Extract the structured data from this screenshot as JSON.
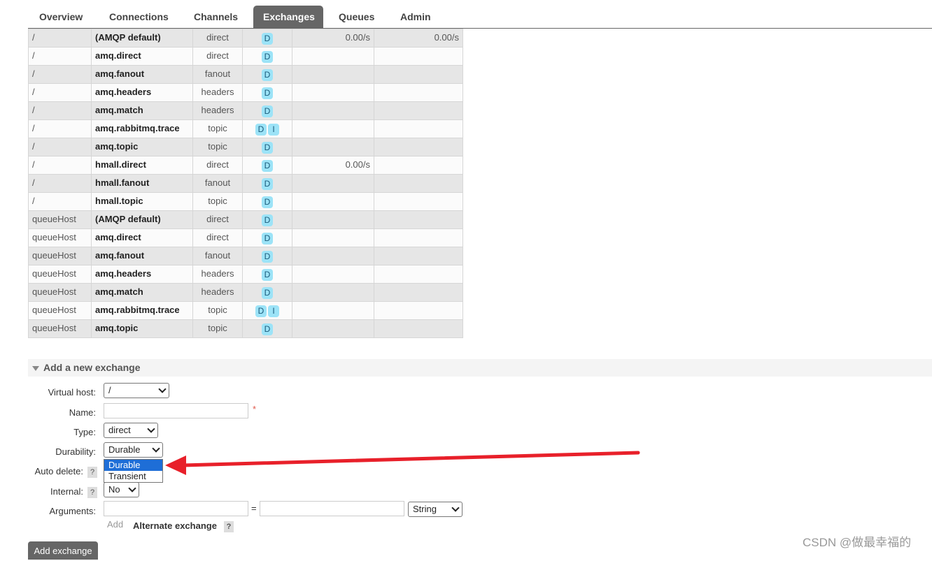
{
  "tabs": [
    "Overview",
    "Connections",
    "Channels",
    "Exchanges",
    "Queues",
    "Admin"
  ],
  "active_tab": "Exchanges",
  "exchanges": [
    {
      "vhost": "/",
      "name": "(AMQP default)",
      "type": "direct",
      "features": [
        "D"
      ],
      "rate_in": "0.00/s",
      "rate_out": "0.00/s"
    },
    {
      "vhost": "/",
      "name": "amq.direct",
      "type": "direct",
      "features": [
        "D"
      ],
      "rate_in": "",
      "rate_out": ""
    },
    {
      "vhost": "/",
      "name": "amq.fanout",
      "type": "fanout",
      "features": [
        "D"
      ],
      "rate_in": "",
      "rate_out": ""
    },
    {
      "vhost": "/",
      "name": "amq.headers",
      "type": "headers",
      "features": [
        "D"
      ],
      "rate_in": "",
      "rate_out": ""
    },
    {
      "vhost": "/",
      "name": "amq.match",
      "type": "headers",
      "features": [
        "D"
      ],
      "rate_in": "",
      "rate_out": ""
    },
    {
      "vhost": "/",
      "name": "amq.rabbitmq.trace",
      "type": "topic",
      "features": [
        "D",
        "I"
      ],
      "rate_in": "",
      "rate_out": ""
    },
    {
      "vhost": "/",
      "name": "amq.topic",
      "type": "topic",
      "features": [
        "D"
      ],
      "rate_in": "",
      "rate_out": ""
    },
    {
      "vhost": "/",
      "name": "hmall.direct",
      "type": "direct",
      "features": [
        "D"
      ],
      "rate_in": "0.00/s",
      "rate_out": ""
    },
    {
      "vhost": "/",
      "name": "hmall.fanout",
      "type": "fanout",
      "features": [
        "D"
      ],
      "rate_in": "",
      "rate_out": ""
    },
    {
      "vhost": "/",
      "name": "hmall.topic",
      "type": "topic",
      "features": [
        "D"
      ],
      "rate_in": "",
      "rate_out": ""
    },
    {
      "vhost": "queueHost",
      "name": "(AMQP default)",
      "type": "direct",
      "features": [
        "D"
      ],
      "rate_in": "",
      "rate_out": ""
    },
    {
      "vhost": "queueHost",
      "name": "amq.direct",
      "type": "direct",
      "features": [
        "D"
      ],
      "rate_in": "",
      "rate_out": ""
    },
    {
      "vhost": "queueHost",
      "name": "amq.fanout",
      "type": "fanout",
      "features": [
        "D"
      ],
      "rate_in": "",
      "rate_out": ""
    },
    {
      "vhost": "queueHost",
      "name": "amq.headers",
      "type": "headers",
      "features": [
        "D"
      ],
      "rate_in": "",
      "rate_out": ""
    },
    {
      "vhost": "queueHost",
      "name": "amq.match",
      "type": "headers",
      "features": [
        "D"
      ],
      "rate_in": "",
      "rate_out": ""
    },
    {
      "vhost": "queueHost",
      "name": "amq.rabbitmq.trace",
      "type": "topic",
      "features": [
        "D",
        "I"
      ],
      "rate_in": "",
      "rate_out": ""
    },
    {
      "vhost": "queueHost",
      "name": "amq.topic",
      "type": "topic",
      "features": [
        "D"
      ],
      "rate_in": "",
      "rate_out": ""
    }
  ],
  "form": {
    "section_title": "Add a new exchange",
    "vhost_label": "Virtual host:",
    "vhost_value": "/",
    "name_label": "Name:",
    "name_required": "*",
    "type_label": "Type:",
    "type_value": "direct",
    "durability_label": "Durability:",
    "durability_value": "Durable",
    "durability_options": [
      "Durable",
      "Transient"
    ],
    "autodelete_label": "Auto delete:",
    "internal_label": "Internal:",
    "internal_value": "No",
    "arguments_label": "Arguments:",
    "equals": "=",
    "arg_type_value": "String",
    "add_link": "Add",
    "alternate_exchange": "Alternate exchange",
    "help": "?",
    "submit": "Add exchange"
  },
  "watermark": "CSDN @做最幸福的",
  "colors": {
    "tab_active": "#666666",
    "badge": "#9ce3f7",
    "arrow": "#e8202a",
    "dropdown_highlight": "#1e6ed7"
  }
}
